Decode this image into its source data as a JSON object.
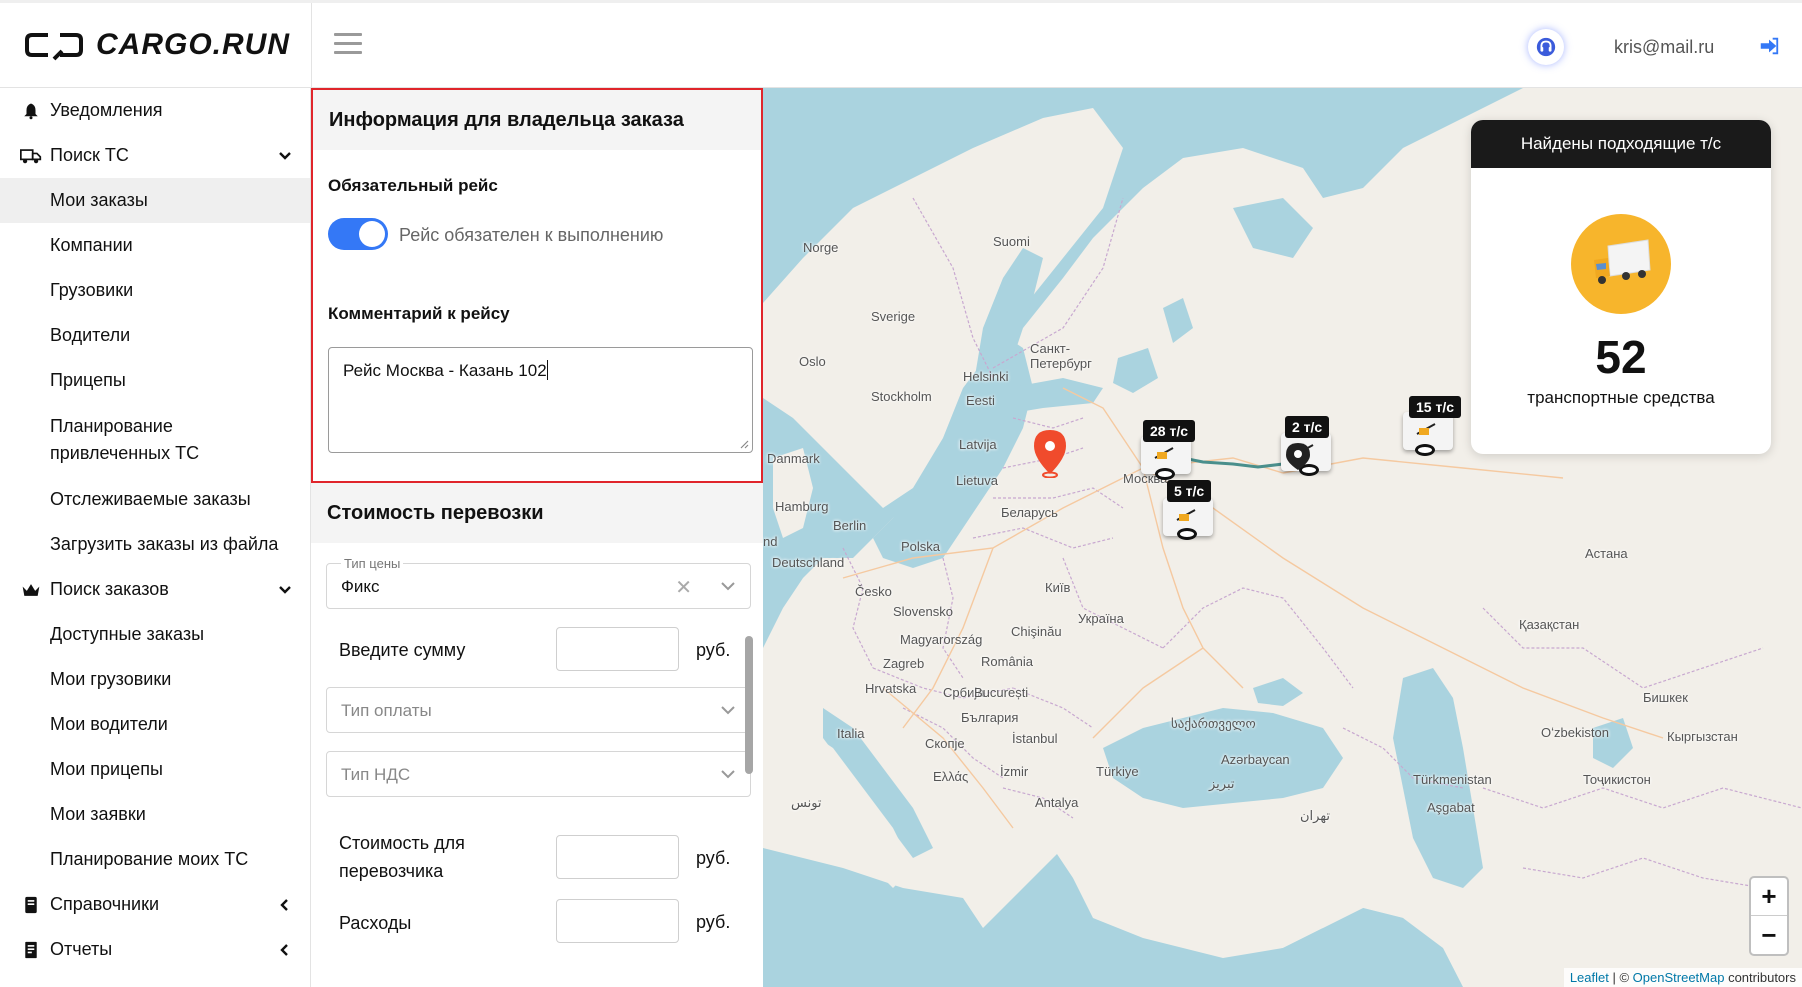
{
  "app": {
    "logo_text": "CARGO.RUN",
    "user_email": "kris@mail.ru",
    "accent_color": "#3478f6",
    "highlight_color": "#e0252b"
  },
  "sidebar": {
    "notifications": "Уведомления",
    "search_vehicles": "Поиск ТС",
    "search_vehicles_items": [
      "Мои заказы",
      "Компании",
      "Грузовики",
      "Водители",
      "Прицепы",
      "Планирование привлеченных ТС",
      "Отслеживаемые заказы",
      "Загрузить заказы из файла"
    ],
    "search_orders": "Поиск заказов",
    "search_orders_items": [
      "Доступные заказы",
      "Мои грузовики",
      "Мои водители",
      "Мои прицепы",
      "Мои заявки",
      "Планирование моих ТС"
    ],
    "references": "Справочники",
    "reports": "Отчеты",
    "active_item": "Мои заказы"
  },
  "owner_info": {
    "title": "Информация для владельца заказа",
    "mandatory_title": "Обязательный рейс",
    "toggle_label": "Рейс обязателен к выполнению",
    "toggle_on": true,
    "comment_title": "Комментарий к рейсу",
    "comment_value": "Рейс Москва - Казань 102"
  },
  "cost": {
    "title": "Стоимость перевозки",
    "price_type_label": "Тип цены",
    "price_type_value": "Фикс",
    "amount_label": "Введите сумму",
    "currency": "руб.",
    "payment_type_placeholder": "Тип оплаты",
    "vat_type_placeholder": "Тип НДС",
    "carrier_cost_label": "Стоимость для перевозчика",
    "expenses_label": "Расходы"
  },
  "map": {
    "labels": {
      "norge": "Norge",
      "suomi": "Suomi",
      "sverige": "Sverige",
      "oslo": "Oslo",
      "spb": "Санкт-Петербург",
      "helsinki": "Helsinki",
      "stockholm": "Stockholm",
      "eesti": "Eesti",
      "latvija": "Latvija",
      "danmark": "Danmark",
      "lietuva": "Lietuva",
      "moskva": "Москва",
      "belarus": "Беларусь",
      "hamburg": "Hamburg",
      "berlin": "Berlin",
      "polska": "Polska",
      "nd": "nd",
      "deutschland": "Deutschland",
      "cesko": "Česko",
      "kyiv": "Київ",
      "slovensko": "Slovensko",
      "ukraina": "Україна",
      "magyarorszag": "Magyarország",
      "chisinau": "Chişinău",
      "zagreb": "Zagreb",
      "romania": "România",
      "hrvatska": "Hrvatska",
      "srbija": "Србија",
      "bucuresti": "București",
      "bulgaria": "България",
      "italia": "Italia",
      "skopje": "Скопје",
      "istanbul": "İstanbul",
      "georgia": "საქართველო",
      "azerbaycan": "Azərbaycan",
      "turkiye": "Türkiye",
      "izmir": "İzmir",
      "ellas": "Ελλάς",
      "antalya": "Antalya",
      "tbilisi_script": "تبریز",
      "nus": "تونس",
      "tehran": "تهران",
      "astana": "Астана",
      "kazakhstan": "Қазақстан",
      "bishkek": "Бишкек",
      "ozbekiston": "Oʻzbekiston",
      "kyrgyzstan": "Кыргызстан",
      "turkmenistan": "Türkmenistan",
      "tojikiston": "Тоҷикистон",
      "asgabat": "Aşgabat"
    },
    "clusters": [
      {
        "label": "28 т/с"
      },
      {
        "label": "2 т/с"
      },
      {
        "label": "15 т/с"
      },
      {
        "label": "5 т/с"
      }
    ],
    "found_card": {
      "title": "Найдены подходящие т/с",
      "count": "52",
      "subtitle": "транспортные средства"
    },
    "zoom_in": "+",
    "zoom_out": "−",
    "attribution_leaflet": "Leaflet",
    "attribution_sep": " | © ",
    "attribution_osm": "OpenStreetMap",
    "attribution_tail": " contributors"
  }
}
